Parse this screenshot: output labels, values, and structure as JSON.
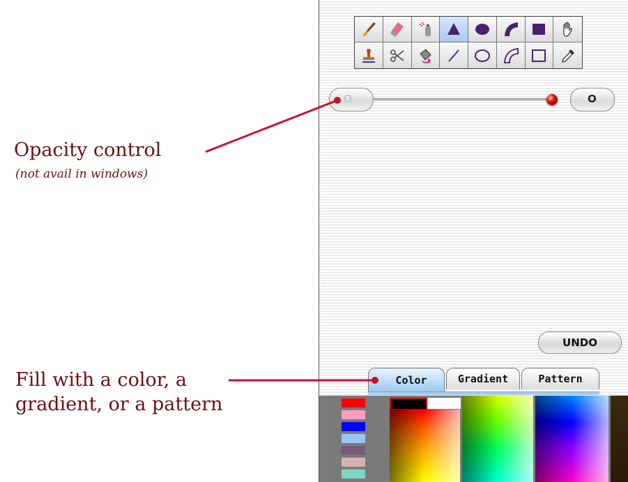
{
  "annotations": {
    "opacity_title": "Opacity control",
    "opacity_note": "(not avail in windows)",
    "fill_line1": "Fill with a color, a",
    "fill_line2": "gradient, or a pattern"
  },
  "toolbox": {
    "tools": [
      {
        "icon": "brush-icon"
      },
      {
        "icon": "eraser-icon"
      },
      {
        "icon": "spray-can-icon"
      },
      {
        "icon": "filled-triangle-icon",
        "selected": true
      },
      {
        "icon": "filled-ellipse-icon"
      },
      {
        "icon": "filled-arc-icon"
      },
      {
        "icon": "filled-rectangle-icon"
      },
      {
        "icon": "hand-icon"
      },
      {
        "icon": "stamp-icon"
      },
      {
        "icon": "scissors-icon"
      },
      {
        "icon": "paint-bucket-icon"
      },
      {
        "icon": "line-icon"
      },
      {
        "icon": "outline-ellipse-icon"
      },
      {
        "icon": "outline-arc-icon"
      },
      {
        "icon": "outline-rectangle-icon"
      },
      {
        "icon": "eyedropper-icon"
      }
    ]
  },
  "opacity": {
    "min_label": "O",
    "max_label": "O",
    "value": 1.0
  },
  "undo_label": "UNDO",
  "fill_tabs": [
    "Color",
    "Gradient",
    "Pattern"
  ],
  "active_tab": "Color",
  "colors": {
    "annotation": "#6b1010",
    "leader_line": "#c8102e",
    "selection_tab": "#9cc9ee"
  },
  "recent_swatches": [
    "#ff0000",
    "#ff9ebf",
    "#0000ff",
    "#9ec4f3",
    "#7a5a7a",
    "#d9b3b3",
    "#7fd6c6"
  ]
}
